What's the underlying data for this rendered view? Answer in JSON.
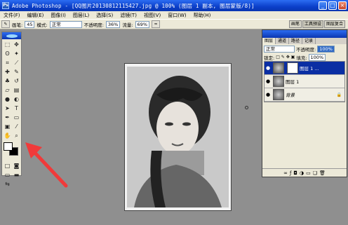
{
  "titlebar": {
    "title": "Adobe Photoshop - [QQ图片20130812115427.jpg @ 100% (图层 1 副本, 图层蒙版/8)]",
    "app_icon": "Ps"
  },
  "window_buttons": {
    "minimize": "_",
    "maximize": "□",
    "close": "×"
  },
  "menu": [
    "文件(F)",
    "编辑(E)",
    "图像(I)",
    "图层(L)",
    "选择(S)",
    "滤镜(T)",
    "视图(V)",
    "窗口(W)",
    "帮助(H)"
  ],
  "options": {
    "brush_label": "画笔:",
    "brush_size": "45",
    "mode_label": "模式:",
    "mode_value": "正常",
    "opacity_label": "不透明度:",
    "opacity_value": "36%",
    "flow_label": "流量:",
    "flow_value": "69%"
  },
  "palette_well": [
    "画笔",
    "工具预设",
    "图层复合"
  ],
  "layers_panel": {
    "tabs": [
      "图层",
      "通道",
      "路径",
      "记录"
    ],
    "blend_mode": "正常",
    "opacity_label": "不透明度:",
    "opacity_value": "100%",
    "lock_label": "锁定:",
    "fill_label": "填充:",
    "fill_value": "100%",
    "layers": [
      {
        "name": "图层 1 ..."
      },
      {
        "name": "图层 1"
      },
      {
        "name": "背景"
      }
    ]
  },
  "colors": {
    "accent": "#0a36b0",
    "arrow": "#f03a3a"
  }
}
